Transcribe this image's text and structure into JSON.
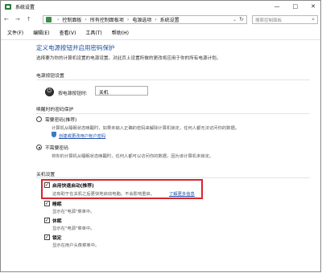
{
  "window": {
    "title": "系统设置",
    "controls": [
      "—",
      "□",
      "✕"
    ]
  },
  "address_bar": {
    "crumbs": [
      "控制面板",
      "所有控制面板项",
      "电源选项",
      "系统设置"
    ],
    "search_placeholder": "搜索控制面板"
  },
  "menu": [
    "文件(F)",
    "编辑(E)",
    "查看(V)",
    "工具(T)",
    "帮助(H)"
  ],
  "main": {
    "title": "定义电源按钮并启用密码保护",
    "subtitle": "选择要为你的计算机设置的电源设置。对此页上设置所做的更改将应用于你的所有电源计划。"
  },
  "power_button_settings": {
    "heading": "电源按钮设置",
    "label": "按电源按钮时:",
    "value": "关机"
  },
  "wake_password": {
    "heading": "唤醒时的密码保护",
    "options": [
      {
        "label": "需要密码(推荐)",
        "selected": false,
        "desc_lines": [
          "计算机从睡眠状态唤醒时，如果未输入正确的密码来解除计算机锁定，任何人都无法访问你的数据。"
        ],
        "link": "创建或更改用户帐户密码"
      },
      {
        "label": "不需要密码",
        "selected": true,
        "desc_lines": [
          "将你的计算机从睡眠状态唤醒时，任何人都可以访问你的数据，因为该计算机未锁定。"
        ]
      }
    ]
  },
  "shutdown_settings": {
    "heading": "关机设置",
    "items": [
      {
        "label": "启用快速启动(推荐)",
        "checked": true,
        "desc": "这有助于在关机之后更快地启动电脑。不会影响重启。",
        "link": "了解更多信息"
      },
      {
        "label": "睡眠",
        "checked": true,
        "desc": "显示在\"电源\"菜单中。"
      },
      {
        "label": "休眠",
        "checked": true,
        "desc": "显示在\"电源\"菜单中。"
      },
      {
        "label": "锁定",
        "checked": true,
        "desc": "显示在用户头像菜单中。"
      }
    ]
  }
}
